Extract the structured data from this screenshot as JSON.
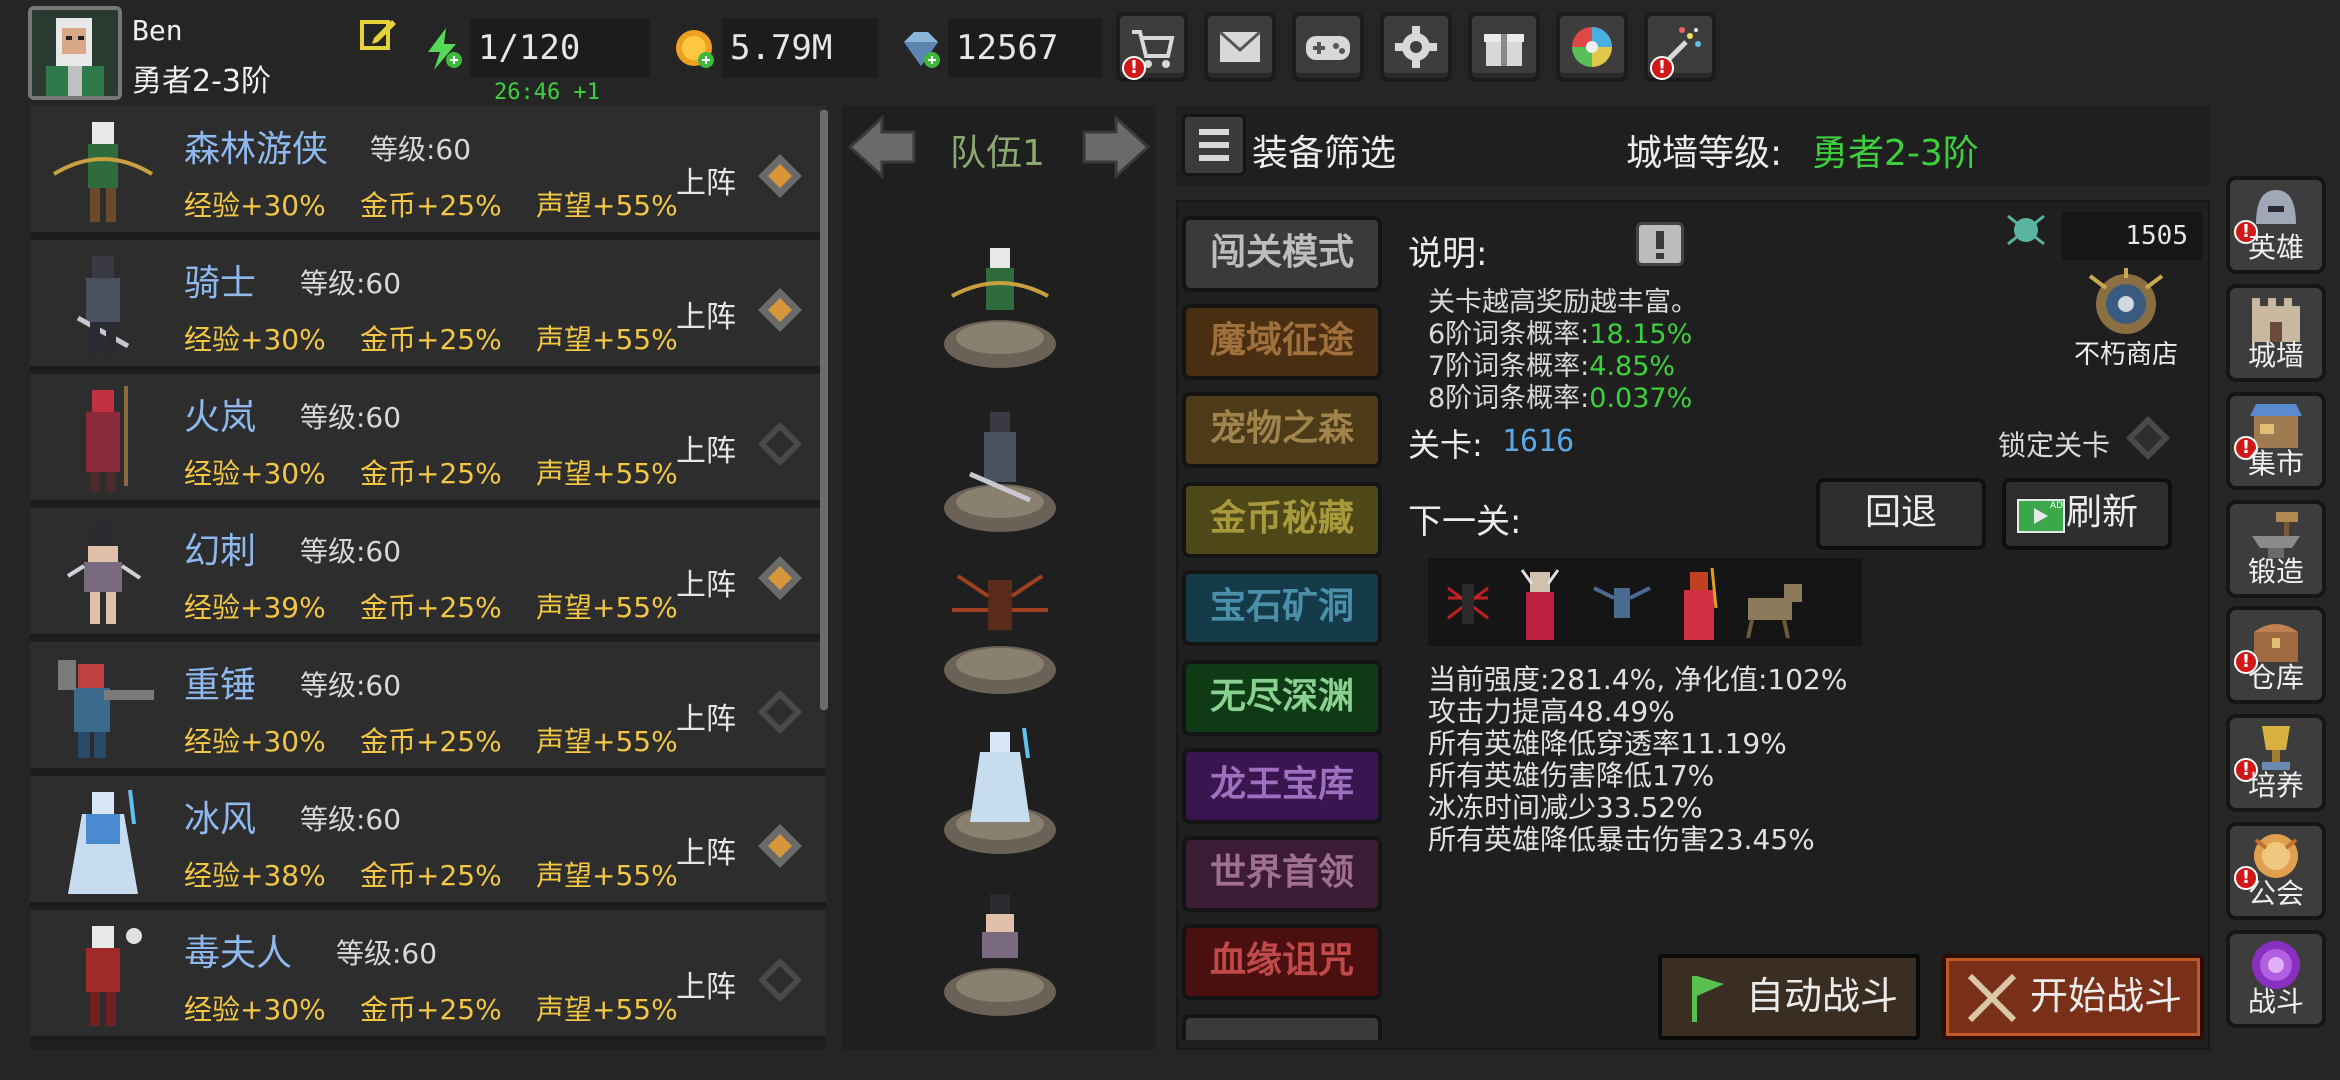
{
  "player": {
    "name": "Ben",
    "rank": "勇者2-3阶"
  },
  "resources": {
    "energy": "1/120",
    "energy_timer": "26:46 +1",
    "gold": "5.79M",
    "gems": "12567"
  },
  "top_buttons": [
    "shop-cart-icon",
    "mail-icon",
    "gamepad-icon",
    "settings-gear-icon",
    "gift-icon",
    "lucky-wheel-icon",
    "firework-icon"
  ],
  "heroes": [
    {
      "name": "森林游侠",
      "level": "等级:60",
      "exp": "经验+30%",
      "gold": "金币+25%",
      "fame": "声望+55%",
      "deploy": "上阵",
      "color": "#2f6b3c"
    },
    {
      "name": "骑士",
      "level": "等级:60",
      "exp": "经验+30%",
      "gold": "金币+25%",
      "fame": "声望+55%",
      "deploy": "上阵",
      "color": "#4a5160"
    },
    {
      "name": "火岚",
      "level": "等级:60",
      "exp": "经验+30%",
      "gold": "金币+25%",
      "fame": "声望+55%",
      "deploy": "上阵",
      "color": "#8c2a3c"
    },
    {
      "name": "幻刺",
      "level": "等级:60",
      "exp": "经验+39%",
      "gold": "金币+25%",
      "fame": "声望+55%",
      "deploy": "上阵",
      "color": "#7a6a80"
    },
    {
      "name": "重锤",
      "level": "等级:60",
      "exp": "经验+30%",
      "gold": "金币+25%",
      "fame": "声望+55%",
      "deploy": "上阵",
      "color": "#3a6a8c"
    },
    {
      "name": "冰风",
      "level": "等级:60",
      "exp": "经验+38%",
      "gold": "金币+25%",
      "fame": "声望+55%",
      "deploy": "上阵",
      "color": "#4a8ad0"
    },
    {
      "name": "毒夫人",
      "level": "等级:60",
      "exp": "经验+30%",
      "gold": "金币+25%",
      "fame": "声望+55%",
      "deploy": "上阵",
      "color": "#a02a2a"
    }
  ],
  "team": {
    "label": "队伍1"
  },
  "filter": {
    "label": "装备筛选",
    "wall_label": "城墙等级:",
    "wall_value": "勇者2-3阶"
  },
  "modes": [
    {
      "label": "闯关模式",
      "bg": "#3a3a3a",
      "fg": "#bdbdbd"
    },
    {
      "label": "魔域征途",
      "bg": "#4a2e12",
      "fg": "#a0703c"
    },
    {
      "label": "宠物之森",
      "bg": "#4c3a18",
      "fg": "#a0844c"
    },
    {
      "label": "金币秘藏",
      "bg": "#4e4818",
      "fg": "#a89a3c"
    },
    {
      "label": "宝石矿洞",
      "bg": "#153a4a",
      "fg": "#4a90a8"
    },
    {
      "label": "无尽深渊",
      "bg": "#0f3a16",
      "fg": "#8ad090"
    },
    {
      "label": "龙王宝库",
      "bg": "#3a1650",
      "fg": "#a070c0"
    },
    {
      "label": "世界首领",
      "bg": "#3c1c34",
      "fg": "#a07090"
    },
    {
      "label": "血缘诅咒",
      "bg": "#4a1010",
      "fg": "#c04a4a"
    }
  ],
  "description": {
    "label": "说明:",
    "line1": "关卡越高奖励越丰富。",
    "rows": [
      {
        "label": "6阶词条概率:",
        "value": "18.15%"
      },
      {
        "label": "7阶词条概率:",
        "value": "4.85%"
      },
      {
        "label": "8阶词条概率:",
        "value": "0.037%"
      }
    ]
  },
  "shop": {
    "count": "1505",
    "label": "不朽商店"
  },
  "stage": {
    "label": "关卡:",
    "value": "1616",
    "lock_label": "锁定关卡"
  },
  "next": {
    "label": "下一关:",
    "retreat": "回退",
    "refresh": "刷新",
    "ad_badge": "AD"
  },
  "enemy_stats": [
    "当前强度:281.4%, 净化值:102%",
    "攻击力提高48.49%",
    "所有英雄降低穿透率11.19%",
    "所有英雄伤害降低17%",
    "冰冻时间减少33.52%",
    "所有英雄降低暴击伤害23.45%"
  ],
  "battle": {
    "auto": "自动战斗",
    "start": "开始战斗"
  },
  "sidebar": [
    {
      "label": "英雄",
      "alert": true
    },
    {
      "label": "城墙",
      "alert": false
    },
    {
      "label": "集市",
      "alert": true
    },
    {
      "label": "锻造",
      "alert": false
    },
    {
      "label": "仓库",
      "alert": true
    },
    {
      "label": "培养",
      "alert": true
    },
    {
      "label": "公会",
      "alert": true
    },
    {
      "label": "战斗",
      "alert": false
    }
  ],
  "colors": {
    "accent_green": "#3cd13c",
    "stat_yellow": "#f3c744",
    "hero_name_blue": "#8fb8ee",
    "stage_blue": "#5aa8e8"
  }
}
